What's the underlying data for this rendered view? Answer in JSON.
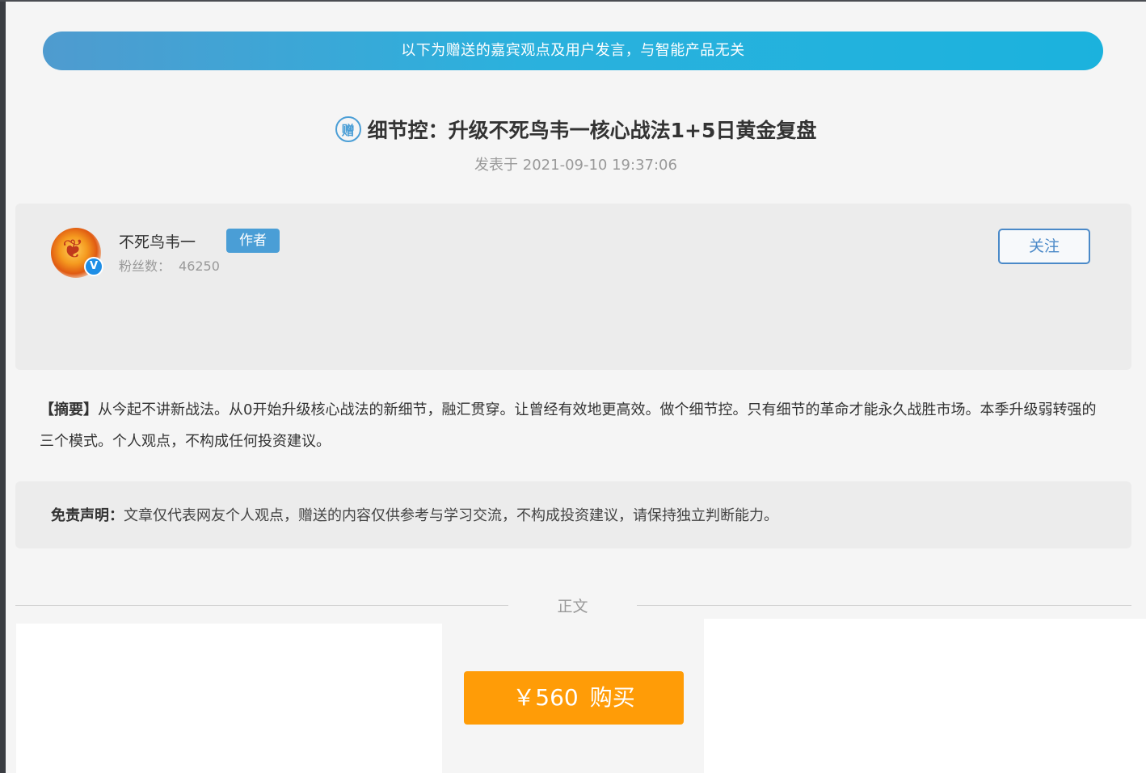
{
  "banner": {
    "text": "以下为赠送的嘉宾观点及用户发言，与智能产品无关"
  },
  "article": {
    "gift_icon_char": "赠",
    "title": "细节控：升级不死鸟韦一核心战法1+5日黄金复盘",
    "published": "发表于 2021-09-10 19:37:06"
  },
  "author": {
    "name": "不死鸟韦一",
    "badge": "作者",
    "fans_label": "粉丝数：",
    "fans_count": "46250",
    "verified_mark": "V",
    "follow_label": "关注"
  },
  "summary": {
    "tag": "【摘要】",
    "text": "从今起不讲新战法。从0开始升级核心战法的新细节，融汇贯穿。让曾经有效地更高效。做个细节控。只有细节的革命才能永久战胜市场。本季升级弱转强的三个模式。个人观点，不构成任何投资建议。"
  },
  "disclaimer": {
    "label": "免责声明：",
    "text": "文章仅代表网友个人观点，赠送的内容仅供参考与学习交流，不构成投资建议，请保持独立判断能力。"
  },
  "divider": {
    "label": "正文"
  },
  "purchase": {
    "price": "￥560",
    "label": "购买"
  },
  "colors": {
    "banner_start": "#4f9bcf",
    "banner_end": "#1bb2dd",
    "accent_blue": "#4a9ed6",
    "buy_orange": "#ff9c07"
  },
  "icons": [
    "gift-icon",
    "verified-icon",
    "avatar-phoenix"
  ]
}
